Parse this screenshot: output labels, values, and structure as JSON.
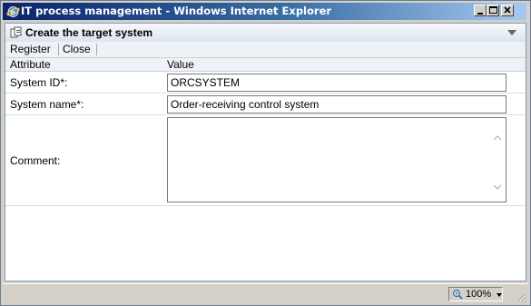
{
  "window": {
    "title": "IT process management - Windows Internet Explorer",
    "icon": "ie-icon"
  },
  "page": {
    "title": "Create the target system",
    "icon": "page-icon"
  },
  "toolbar": {
    "register_label": "Register",
    "close_label": "Close"
  },
  "table": {
    "columns": [
      "Attribute",
      "Value"
    ],
    "rows": [
      {
        "label": "System ID*:",
        "value": "ORCSYSTEM"
      },
      {
        "label": "System name*:",
        "value": "Order-receiving control system"
      },
      {
        "label": "Comment:",
        "value": ""
      }
    ]
  },
  "status": {
    "zoom": "100%"
  }
}
